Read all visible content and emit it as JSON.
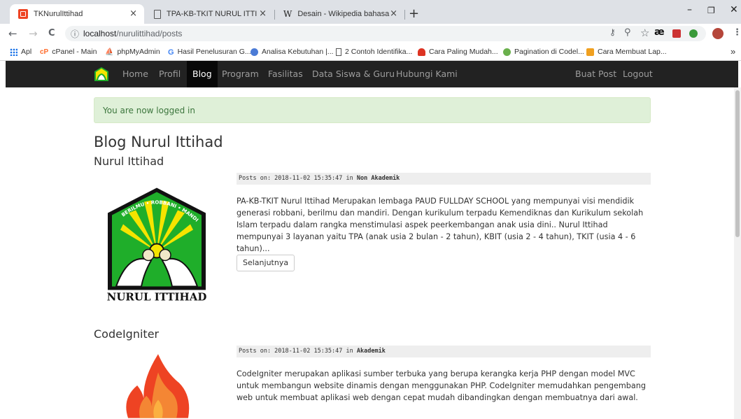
{
  "browser": {
    "tabs": [
      {
        "title": "TKNurulIttihad",
        "active": true
      },
      {
        "title": "TPA-KB-TKIT NURUL ITTIHAD Ma",
        "active": false
      },
      {
        "title": "Desain - Wikipedia bahasa Indon",
        "active": false
      }
    ],
    "new_tab_glyph": "+",
    "window_controls": {
      "minimize": "–",
      "restore": "❐",
      "close": "✕"
    },
    "nav": {
      "back": "←",
      "forward": "→",
      "reload": "C"
    },
    "address": {
      "host": "localhost",
      "path": "/nurulittihad/posts"
    },
    "bookmarks": [
      "Apl",
      "cPanel - Main",
      "phpMyAdmin",
      "Hasil Penelusuran G...",
      "Analisa Kebutuhan |...",
      "2 Contoh Identifika...",
      "Cara Paling Mudah...",
      "Pagination di Codel...",
      "Cara Membuat Lap..."
    ],
    "bookmarks_overflow": "»"
  },
  "site_nav": {
    "links": [
      "Home",
      "Profil",
      "Blog",
      "Program",
      "Fasilitas",
      "Data Siswa & Guru",
      "Hubungi Kami"
    ],
    "active": "Blog",
    "right_links": [
      "Buat Post",
      "Logout"
    ]
  },
  "alert": {
    "text": "You are now logged in"
  },
  "page_title": "Blog Nurul Ittihad",
  "posts": [
    {
      "title": "Nurul Ittihad",
      "meta_prefix": "Posts on: 2018-11-02 15:35:47 in ",
      "category": "Non Akademik",
      "body": "PA-KB-TKIT Nurul Ittihad Merupakan lembaga PAUD FULLDAY SCHOOL yang mempunyai visi mendidik generasi robbani, berilmu dan mandiri. Dengan kurikulum terpadu Kemendiknas dan Kurikulum sekolah Islam terpadu dalam rangka menstimulasi aspek peerkembangan anak usia dini.. Nurul Ittihad mempunyai 3 layanan yaitu TPA (anak usia 2 bulan - 2 tahun), KBIT (usia 2 - 4 tahun), TKIT (usia 4 - 6 tahun)...",
      "button": "Selanjutnya",
      "logo_text": "NURUL ITTIHAD",
      "logo_arc_text": "BERILMU • ROBBANI • MANDIRI"
    },
    {
      "title": "CodeIgniter",
      "meta_prefix": "Posts on: 2018-11-02 15:35:47 in ",
      "category": "Akademik",
      "body": "CodeIgniter merupakan aplikasi sumber terbuka yang berupa kerangka kerja PHP dengan model MVC untuk membangun website dinamis dengan menggunakan PHP. CodeIgniter memudahkan pengembang web untuk membuat aplikasi web dengan cepat mudah dibandingkan dengan membuatnya dari awal."
    }
  ],
  "colors": {
    "navbar_bg": "#222222",
    "alert_bg": "#dff0d8",
    "alert_text": "#3c763d",
    "logo_green": "#1fae2a",
    "logo_yellow": "#f5e400",
    "ci_orange": "#ee4323"
  }
}
